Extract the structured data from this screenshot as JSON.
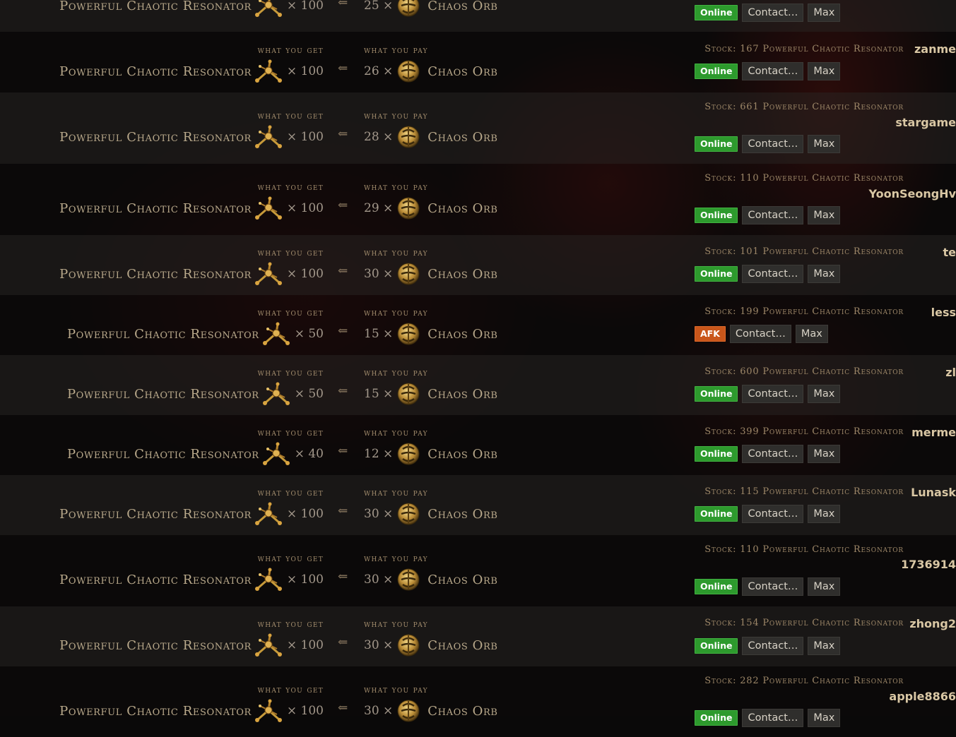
{
  "labels": {
    "what_you_get": "what you get",
    "what_you_pay": "what you pay",
    "arrow": "⇐",
    "times": "×",
    "contact": "Contact…",
    "max": "Max",
    "stock_prefix": "Stock:"
  },
  "item": {
    "name": "Powerful Chaotic Resonator",
    "icon": "powerful-chaotic-resonator-icon"
  },
  "currency": {
    "name": "Chaos Orb",
    "icon": "chaos-orb-icon"
  },
  "status_colors": {
    "online": "#2d9a2d",
    "afk": "#c9561b"
  },
  "listings": [
    {
      "get_qty": "100",
      "pay_qty": "25",
      "stock_text": "",
      "account": "",
      "status": "Online"
    },
    {
      "get_qty": "100",
      "pay_qty": "26",
      "stock_text": "Stock: 167 Powerful Chaotic Resonator",
      "account": "zanme",
      "status": "Online"
    },
    {
      "get_qty": "100",
      "pay_qty": "28",
      "stock_text": "Stock: 661 Powerful Chaotic Resonator",
      "account": "stargame",
      "status": "Online"
    },
    {
      "get_qty": "100",
      "pay_qty": "29",
      "stock_text": "Stock: 110 Powerful Chaotic Resonator",
      "account": "YoonSeongHv",
      "status": "Online"
    },
    {
      "get_qty": "100",
      "pay_qty": "30",
      "stock_text": "Stock: 101 Powerful Chaotic Resonator",
      "account": "te",
      "status": "Online"
    },
    {
      "get_qty": "50",
      "pay_qty": "15",
      "stock_text": "Stock: 199 Powerful Chaotic Resonator",
      "account": "less",
      "status": "AFK"
    },
    {
      "get_qty": "50",
      "pay_qty": "15",
      "stock_text": "Stock: 600 Powerful Chaotic Resonator",
      "account": "zl",
      "status": "Online"
    },
    {
      "get_qty": "40",
      "pay_qty": "12",
      "stock_text": "Stock: 399 Powerful Chaotic Resonator",
      "account": "merme",
      "status": "Online"
    },
    {
      "get_qty": "100",
      "pay_qty": "30",
      "stock_text": "Stock: 115 Powerful Chaotic Resonator",
      "account": "Lunask",
      "status": "Online"
    },
    {
      "get_qty": "100",
      "pay_qty": "30",
      "stock_text": "Stock: 110 Powerful Chaotic Resonator",
      "account": "1736914",
      "status": "Online"
    },
    {
      "get_qty": "100",
      "pay_qty": "30",
      "stock_text": "Stock: 154 Powerful Chaotic Resonator",
      "account": "zhong2",
      "status": "Online"
    },
    {
      "get_qty": "100",
      "pay_qty": "30",
      "stock_text": "Stock: 282 Powerful Chaotic Resonator",
      "account": "apple8866",
      "status": "Online"
    }
  ]
}
